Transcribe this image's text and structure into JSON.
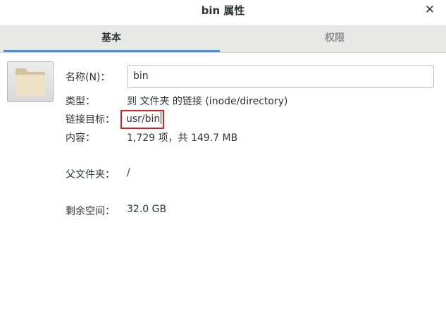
{
  "window": {
    "title": "bin 属性",
    "close_glyph": "✕"
  },
  "tabs": [
    {
      "label": "基本",
      "active": true
    },
    {
      "label": "权限",
      "active": false
    }
  ],
  "icon": {
    "name": "folder-icon",
    "color": "#e8dcc0"
  },
  "fields": {
    "name_label": "名称(N)：",
    "name_value": "bin",
    "type_label": "类型：",
    "type_value": "到 文件夹 的链接 (inode/directory)",
    "link_target_label": "链接目标：",
    "link_target_value": "usr/bin",
    "contents_label": "内容：",
    "contents_value": "1,729 项，共 149.7 MB",
    "parent_label": "父文件夹：",
    "parent_value": "/",
    "free_space_label": "剩余空间：",
    "free_space_value": "32.0 GB"
  },
  "colors": {
    "accent": "#4a90d9",
    "highlight_box": "#d81e1e"
  }
}
